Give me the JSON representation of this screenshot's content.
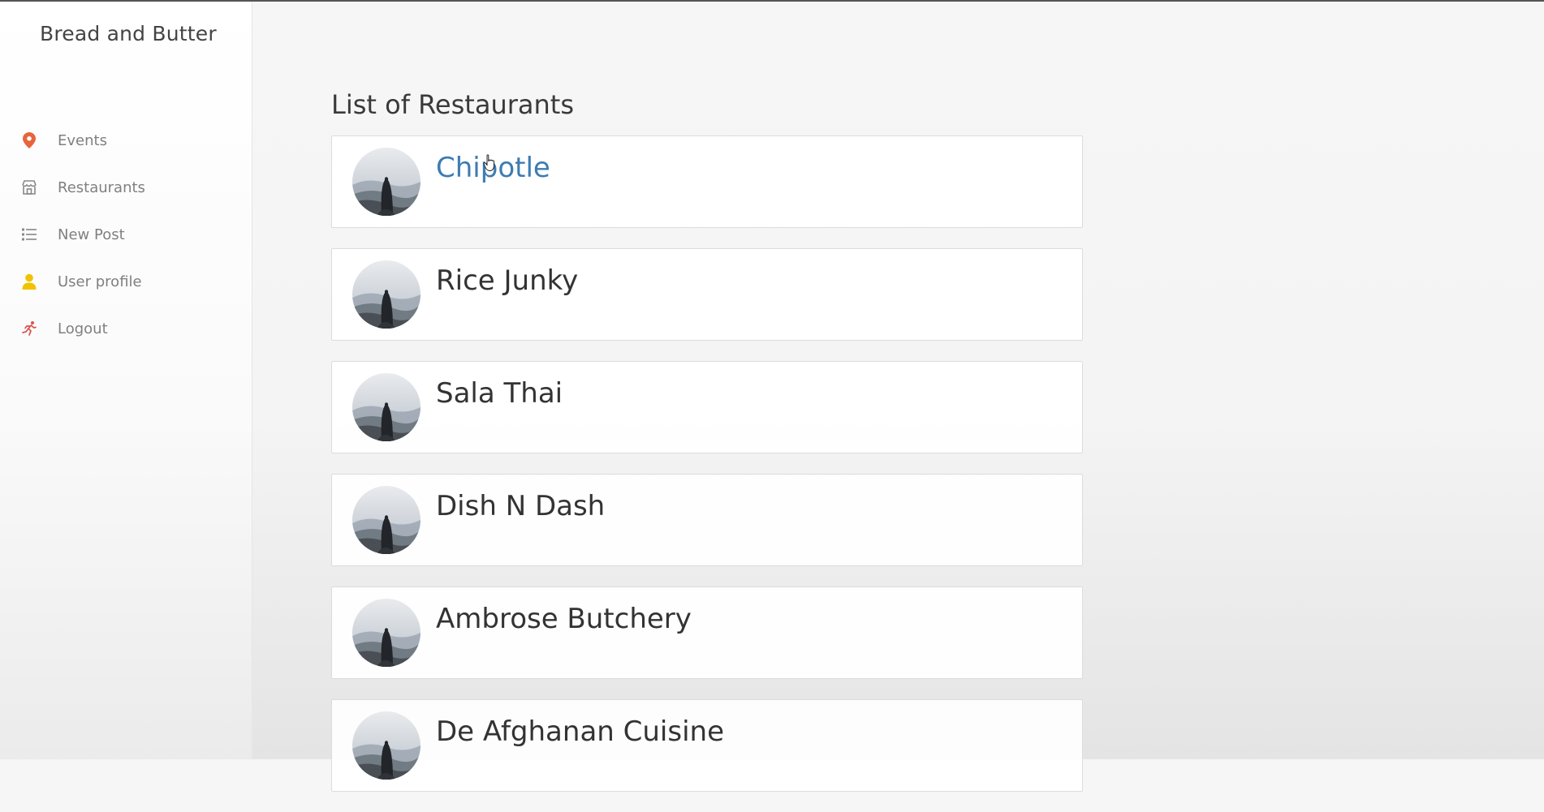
{
  "app": {
    "brand": "Bread and Butter"
  },
  "sidebar": {
    "items": [
      {
        "label": "Events",
        "icon": "map-pin-icon",
        "color": "#e8643c"
      },
      {
        "label": "Restaurants",
        "icon": "store-icon",
        "color": "#888888"
      },
      {
        "label": "New Post",
        "icon": "list-icon",
        "color": "#888888"
      },
      {
        "label": "User profile",
        "icon": "user-icon",
        "color": "#f2c200"
      },
      {
        "label": "Logout",
        "icon": "running-person-icon",
        "color": "#d9534f"
      }
    ]
  },
  "main": {
    "title": "List of Restaurants",
    "restaurants": [
      {
        "name": "Chipotle",
        "highlighted": true
      },
      {
        "name": "Rice Junky"
      },
      {
        "name": "Sala Thai"
      },
      {
        "name": "Dish N Dash"
      },
      {
        "name": "Ambrose Butchery"
      },
      {
        "name": "De Afghanan Cuisine"
      }
    ],
    "link_color": "#3d7cb3"
  }
}
